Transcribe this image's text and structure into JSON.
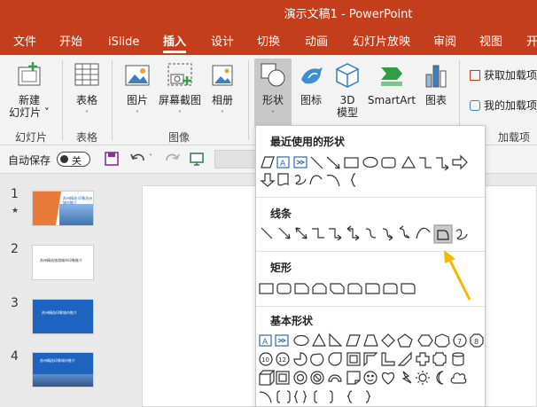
{
  "window": {
    "title": "演示文稿1  -  PowerPoint"
  },
  "tabs": [
    {
      "label": "文件"
    },
    {
      "label": "开始"
    },
    {
      "label": "iSlide"
    },
    {
      "label": "插入"
    },
    {
      "label": "设计"
    },
    {
      "label": "切换"
    },
    {
      "label": "动画"
    },
    {
      "label": "幻灯片放映"
    },
    {
      "label": "审阅"
    },
    {
      "label": "视图"
    },
    {
      "label": "开"
    }
  ],
  "ribbon": {
    "new_slide": {
      "line1": "新建",
      "line2": "幻灯片"
    },
    "table": "表格",
    "picture": "图片",
    "screenshot": "屏幕截图",
    "album": "相册",
    "shapes": "形状",
    "icons": "图标",
    "model3d": {
      "line1": "3D",
      "line2": "模型"
    },
    "smartart": "SmartArt",
    "chart": "图表",
    "get_addins": "获取加载项",
    "my_addins": "我的加载项",
    "groups": {
      "slides": "幻灯片",
      "tables": "表格",
      "images": "图像",
      "addins": "加载项"
    }
  },
  "qat": {
    "autosave_label": "自动保存",
    "toggle_state": "关"
  },
  "thumbnails": [
    {
      "number": "1",
      "starred": true,
      "title": "苏州精选·印象苏州城市推介"
    },
    {
      "number": "2",
      "starred": false,
      "title": "苏州精选旅游城市印象推介"
    },
    {
      "number": "3",
      "starred": false,
      "title": "苏州精选印象城市推介"
    },
    {
      "number": "4",
      "starred": false,
      "title": "苏州精选印象城市推介"
    }
  ],
  "shapes_menu": {
    "recent_header": "最近使用的形状",
    "lines_header": "线条",
    "rect_header": "矩形",
    "basic_header": "基本形状",
    "highlighted_shape": "freeform-shape"
  },
  "colors": {
    "accent": "#c43e1c",
    "arrow": "#f5b800",
    "thumb_blue": "#1e63c0",
    "thumb_orange": "#e87a3a"
  }
}
